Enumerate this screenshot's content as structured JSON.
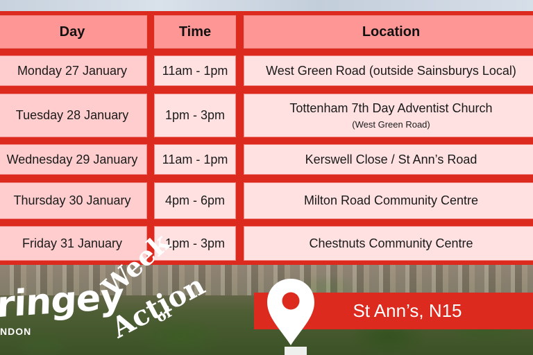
{
  "table": {
    "headers": {
      "day": "Day",
      "time": "Time",
      "location": "Location"
    },
    "rows": [
      {
        "day": "Monday 27 January",
        "time": "11am - 1pm",
        "location": "West Green Road (outside Sainsburys Local)",
        "location_sub": ""
      },
      {
        "day": "Tuesday 28 January",
        "time": "1pm - 3pm",
        "location": "Tottenham 7th Day Adventist Church",
        "location_sub": "(West Green Road)"
      },
      {
        "day": "Wednesday 29 January",
        "time": "11am - 1pm",
        "location": "Kerswell Close / St Ann’s Road",
        "location_sub": ""
      },
      {
        "day": "Thursday 30 January",
        "time": "4pm - 6pm",
        "location": "Milton Road Community Centre",
        "location_sub": ""
      },
      {
        "day": "Friday 31 January",
        "time": "1pm - 3pm",
        "location": "Chestnuts Community Centre",
        "location_sub": ""
      }
    ]
  },
  "branding": {
    "logo_text": "Haringey",
    "logo_visible_text": "ringey",
    "logo_subtext": "NDON",
    "campaign_line1": "Week",
    "campaign_line2": "of",
    "campaign_line3": "Action"
  },
  "location_banner": {
    "icon": "map-pin-icon",
    "text": "St Ann’s, N15"
  },
  "colors": {
    "brand_red": "#dc2a1f",
    "header_fill": "#fe9696",
    "day_fill": "#ffcdcd",
    "cell_fill": "#ffe1e1"
  }
}
